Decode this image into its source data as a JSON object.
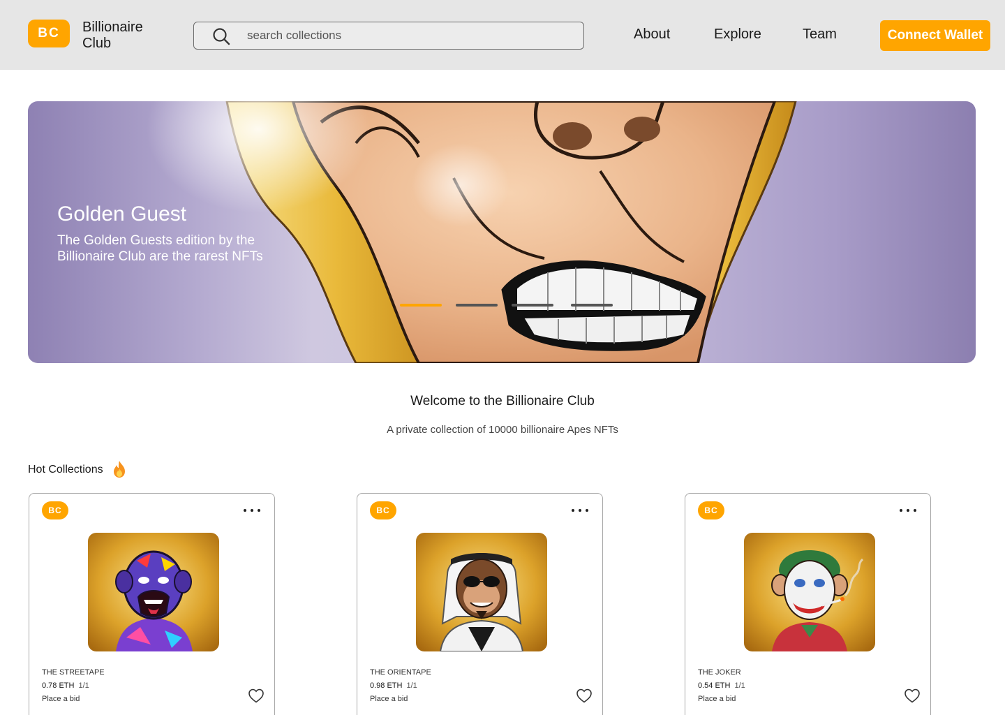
{
  "brand": {
    "logo": "BC",
    "name": "Billionaire Club"
  },
  "search": {
    "placeholder": "search collections",
    "value": ""
  },
  "nav": {
    "about": "About",
    "explore": "Explore",
    "team": "Team"
  },
  "header": {
    "connect_label": "Connect Wallet"
  },
  "hero": {
    "title": "Golden Guest",
    "subtitle": "The Golden Guests edition by the Billionaire Club are the rarest NFTs",
    "active_slide": 1,
    "slide_count": 4
  },
  "welcome": {
    "title": "Welcome to the Billionaire Club",
    "subtitle": "A private collection of 10000 billionaire Apes NFTs"
  },
  "hot": {
    "title": "Hot Collections",
    "icon": "fire-icon"
  },
  "cards": [
    {
      "badge": "BC",
      "name": "THE STREETAPE",
      "price": "0.78 ETH",
      "edition": "1/1",
      "bid": "Place a bid"
    },
    {
      "badge": "BC",
      "name": "THE ORIENTAPE",
      "price": "0.98 ETH",
      "edition": "1/1",
      "bid": "Place a bid"
    },
    {
      "badge": "BC",
      "name": "THE JOKER",
      "price": "0.54 ETH",
      "edition": "1/1",
      "bid": "Place a bid"
    }
  ],
  "colors": {
    "accent": "#ffa500",
    "header_bg": "#e6e6e6",
    "hero_bg": "#c7bfdd"
  }
}
